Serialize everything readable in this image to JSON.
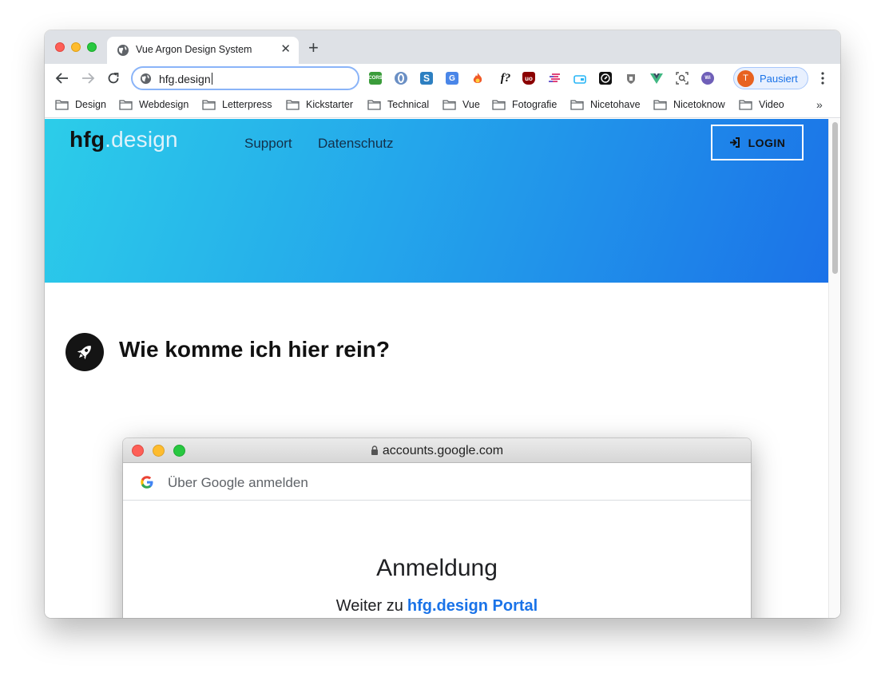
{
  "browser": {
    "tab_title": "Vue Argon Design System",
    "new_tab_symbol": "+",
    "close_symbol": "✕",
    "url": "hfg.design",
    "profile_initial": "T",
    "profile_label": "Pausiert",
    "overflow_symbol": "»",
    "accent_color": "#1a73e8"
  },
  "extensions": [
    {
      "name": "cors-icon",
      "text": "CORS",
      "color": "#3a9c3a"
    },
    {
      "name": "opera-icon",
      "text": "",
      "color": "#6a8fc4"
    },
    {
      "name": "s-icon",
      "text": "S",
      "color": "#2d7fc1"
    },
    {
      "name": "translate-icon",
      "text": "G",
      "color": "#4a86e8"
    },
    {
      "name": "fire-icon",
      "text": "",
      "color": "#f05a28"
    },
    {
      "name": "font-icon",
      "text": "f?",
      "color": "#ffffff"
    },
    {
      "name": "ublock-icon",
      "text": "uo",
      "color": "#8b0000"
    },
    {
      "name": "lines-icon",
      "text": "",
      "color": "#e0457b"
    },
    {
      "name": "tv-icon",
      "text": "",
      "color": "#29b6f6"
    },
    {
      "name": "compass-icon",
      "text": "",
      "color": "#111111"
    },
    {
      "name": "shield-icon",
      "text": "",
      "color": "#7a7a7a"
    },
    {
      "name": "vue-icon",
      "text": "",
      "color": "#41b883"
    },
    {
      "name": "inspect-icon",
      "text": "",
      "color": "#666666"
    },
    {
      "name": "whois-icon",
      "text": "",
      "color": "#6f5fb8"
    }
  ],
  "bookmarks": [
    {
      "label": "Design"
    },
    {
      "label": "Webdesign"
    },
    {
      "label": "Letterpress"
    },
    {
      "label": "Kickstarter"
    },
    {
      "label": "Technical"
    },
    {
      "label": "Vue"
    },
    {
      "label": "Fotografie"
    },
    {
      "label": "Nicetohave"
    },
    {
      "label": "Nicetoknow"
    },
    {
      "label": "Video"
    }
  ],
  "site": {
    "brand_bold": "hfg",
    "brand_rest": ".design",
    "nav": [
      {
        "label": "Support"
      },
      {
        "label": "Datenschutz"
      }
    ],
    "login_label": "LOGIN",
    "section_title": "Wie komme ich hier rein?"
  },
  "popup": {
    "url": "accounts.google.com",
    "header_text": "Über Google anmelden",
    "title": "Anmeldung",
    "continue_prefix": "Weiter zu",
    "continue_link": "hfg.design Portal"
  }
}
